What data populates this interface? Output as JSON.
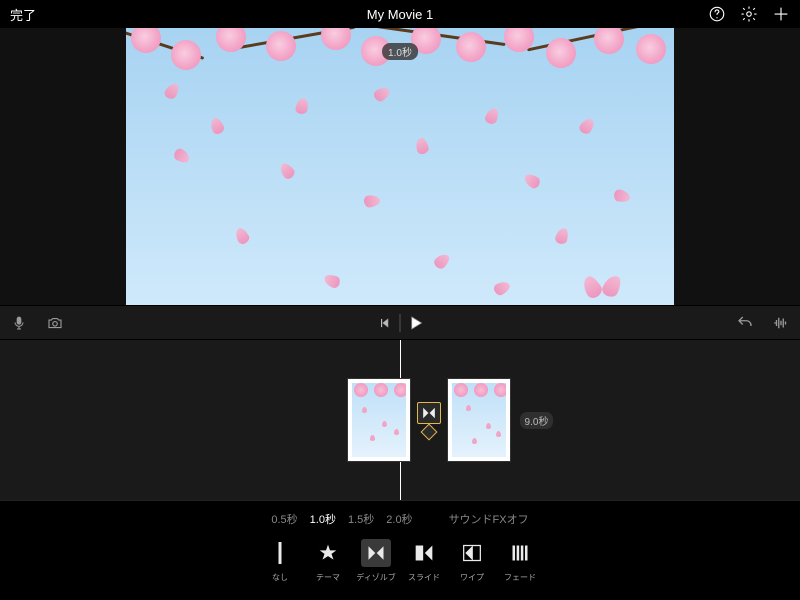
{
  "header": {
    "done_label": "完了",
    "title": "My Movie 1"
  },
  "preview": {
    "duration_badge": "1.0秒"
  },
  "timeline": {
    "clip_duration_label": "9.0秒"
  },
  "durations": {
    "options": [
      "0.5秒",
      "1.0秒",
      "1.5秒",
      "2.0秒"
    ],
    "selected_index": 1,
    "sfx_label": "サウンドFXオフ"
  },
  "transitions": {
    "items": [
      {
        "id": "none",
        "label": "なし"
      },
      {
        "id": "theme",
        "label": "テーマ"
      },
      {
        "id": "dissolve",
        "label": "ディゾルブ"
      },
      {
        "id": "slide",
        "label": "スライド"
      },
      {
        "id": "wipe",
        "label": "ワイプ"
      },
      {
        "id": "fade",
        "label": "フェード"
      }
    ],
    "selected_id": "dissolve"
  }
}
